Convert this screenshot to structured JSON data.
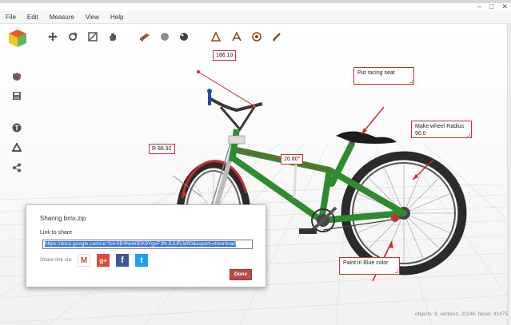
{
  "window": {
    "controls": [
      "–",
      "□",
      "✕"
    ]
  },
  "menu": [
    "File",
    "Edit",
    "Measure",
    "View",
    "Help"
  ],
  "toolbar": {
    "icons": [
      "move-icon",
      "rotate-icon",
      "scale-icon",
      "pan-icon",
      "material-icon",
      "sphere-shading-icon",
      "sphere-glossy-icon",
      "measure-length-icon",
      "measure-angle-icon",
      "measure-radius-icon",
      "annotate-pencil-icon"
    ]
  },
  "sidebar": {
    "icons": [
      "shield-icon",
      "save-icon",
      "tinkercad-icon",
      "google-drive-icon",
      "share-icon"
    ]
  },
  "measurements": {
    "length": "186.10",
    "radius": "R 88.92",
    "angle": "26.80°"
  },
  "annotations": {
    "seat": "Put racing seat",
    "wheel_line1": "Make wheel Radius",
    "wheel_line2": "90.0",
    "paint": "Paint in Blue color"
  },
  "share_dialog": {
    "title": "Sharing bmx.zip",
    "link_label": "Link to share",
    "link_value": "https://docs.google.com/uc?id=0B4Nv60EK9YgeF3fnJUURJd00&export=download",
    "via_label": "Share link via:",
    "services": [
      "M",
      "g+",
      "f",
      "t"
    ],
    "done_label": "Done"
  },
  "status_bar": "objects: 8, vertices: 21146, faces: 41475",
  "colors": {
    "accent_red": "#c9302c",
    "frame_green": "#2e8b2e",
    "done_button": "#b94a48"
  }
}
